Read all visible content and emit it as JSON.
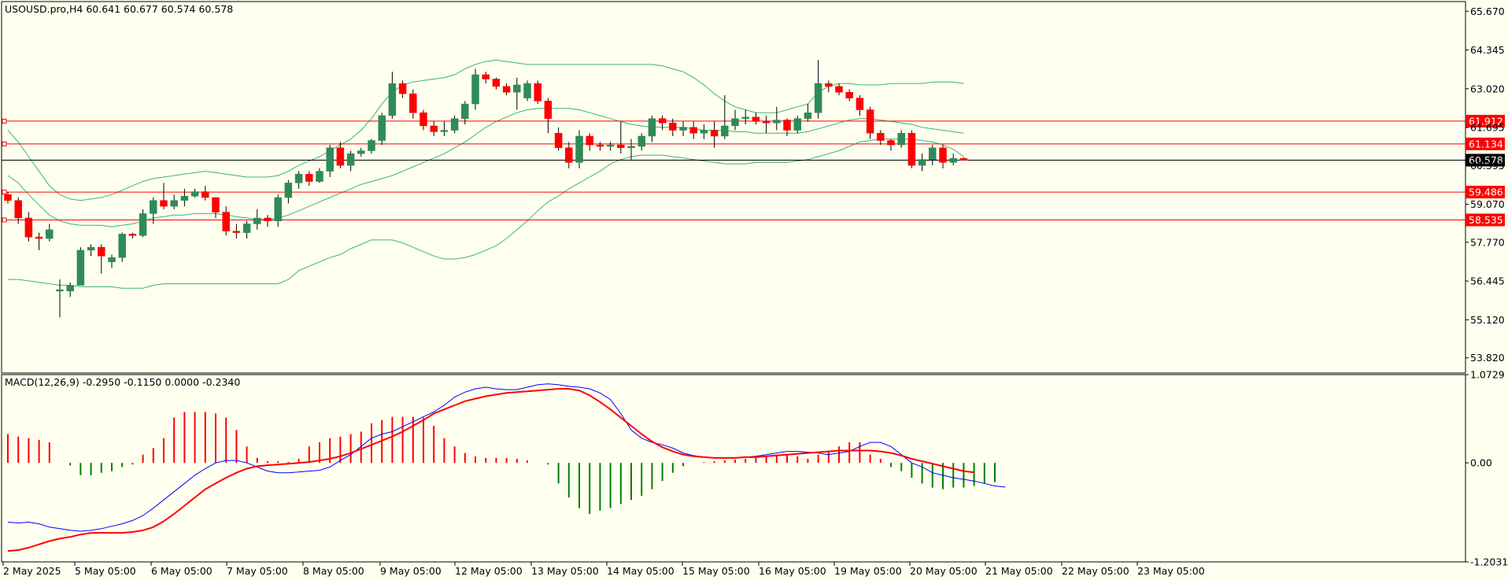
{
  "header": {
    "title": "USOUSD.pro,H4  60.641 60.677 60.574 60.578",
    "macd_title": "MACD(12,26,9) -0.2950 -0.1150 0.0000 -0.2340"
  },
  "colors": {
    "background": "#fffff0",
    "bull": "#2e8b57",
    "bear": "#ff0000",
    "bands": "#3cb371",
    "hline": "#ff0000",
    "price_line": "#000000",
    "macd_line": "#0000ff",
    "signal_line": "#ff0000",
    "hist_pos": "#ff0000",
    "hist_neg": "#008000"
  },
  "chart_data": [
    {
      "type": "candlestick",
      "symbol": "USOUSD.pro",
      "timeframe": "H4",
      "ylim": [
        53.3,
        66.0
      ],
      "yticks": [
        "65.670",
        "64.345",
        "63.020",
        "61.695",
        "60.395",
        "59.070",
        "57.770",
        "56.445",
        "55.120",
        "53.820"
      ],
      "xticks": [
        "2 May 2025",
        "5 May 05:00",
        "6 May 05:00",
        "7 May 05:00",
        "8 May 05:00",
        "9 May 05:00",
        "12 May 05:00",
        "13 May 05:00",
        "14 May 05:00",
        "15 May 05:00",
        "16 May 05:00",
        "19 May 05:00",
        "20 May 05:00",
        "21 May 05:00",
        "22 May 05:00",
        "23 May 05:00"
      ],
      "horizontal_lines": [
        {
          "label": "61.912",
          "value": 61.912
        },
        {
          "label": "61.134",
          "value": 61.134
        },
        {
          "label": "59.486",
          "value": 59.486
        },
        {
          "label": "58.535",
          "value": 58.535
        }
      ],
      "current_price": {
        "label": "60.578",
        "value": 60.578
      },
      "candles": [
        [
          59.4,
          59.2,
          59.5,
          59.1
        ],
        [
          59.2,
          58.6,
          59.3,
          58.4
        ],
        [
          58.6,
          57.95,
          58.8,
          57.8
        ],
        [
          57.95,
          57.9,
          58.1,
          57.5
        ],
        [
          57.9,
          58.2,
          58.4,
          57.8
        ],
        [
          56.1,
          56.15,
          56.5,
          55.2
        ],
        [
          56.1,
          56.3,
          56.4,
          55.9
        ],
        [
          56.3,
          57.5,
          57.6,
          56.3
        ],
        [
          57.5,
          57.6,
          57.7,
          57.3
        ],
        [
          57.6,
          57.3,
          57.7,
          56.7
        ],
        [
          57.1,
          57.25,
          57.35,
          56.9
        ],
        [
          57.25,
          58.05,
          58.1,
          57.1
        ],
        [
          58.05,
          58.0,
          58.1,
          57.9
        ],
        [
          58.0,
          58.75,
          58.9,
          57.95
        ],
        [
          58.75,
          59.2,
          59.3,
          58.4
        ],
        [
          59.2,
          59.0,
          59.8,
          58.9
        ],
        [
          59.0,
          59.2,
          59.4,
          58.9
        ],
        [
          59.2,
          59.35,
          59.6,
          59.0
        ],
        [
          59.35,
          59.5,
          59.6,
          59.3
        ],
        [
          59.5,
          59.3,
          59.7,
          59.2
        ],
        [
          59.3,
          58.8,
          59.3,
          58.6
        ],
        [
          58.8,
          58.15,
          59.0,
          58.0
        ],
        [
          58.15,
          58.1,
          58.4,
          57.9
        ],
        [
          58.1,
          58.4,
          58.5,
          57.9
        ],
        [
          58.4,
          58.6,
          58.9,
          58.2
        ],
        [
          58.6,
          58.5,
          58.7,
          58.3
        ],
        [
          58.5,
          59.3,
          59.4,
          58.3
        ],
        [
          59.3,
          59.8,
          59.9,
          59.1
        ],
        [
          59.8,
          60.1,
          60.2,
          59.6
        ],
        [
          60.1,
          59.85,
          60.2,
          59.7
        ],
        [
          59.85,
          60.2,
          60.3,
          59.8
        ],
        [
          60.2,
          61.0,
          61.1,
          60.0
        ],
        [
          61.0,
          60.4,
          61.2,
          60.3
        ],
        [
          60.4,
          60.8,
          60.9,
          60.2
        ],
        [
          60.8,
          60.9,
          61.0,
          60.7
        ],
        [
          60.9,
          61.25,
          61.3,
          60.8
        ],
        [
          61.25,
          62.1,
          62.2,
          61.1
        ],
        [
          62.1,
          63.2,
          63.6,
          62.0
        ],
        [
          63.2,
          62.85,
          63.3,
          62.7
        ],
        [
          62.85,
          62.2,
          63.0,
          62.0
        ],
        [
          62.2,
          61.75,
          62.3,
          61.6
        ],
        [
          61.75,
          61.55,
          61.9,
          61.4
        ],
        [
          61.55,
          61.6,
          61.9,
          61.4
        ],
        [
          61.6,
          62.0,
          62.1,
          61.5
        ],
        [
          62.0,
          62.5,
          62.6,
          61.8
        ],
        [
          62.5,
          63.5,
          63.7,
          62.3
        ],
        [
          63.5,
          63.35,
          63.6,
          63.2
        ],
        [
          63.35,
          63.1,
          63.4,
          63.0
        ],
        [
          63.1,
          62.9,
          63.2,
          62.8
        ],
        [
          62.9,
          63.15,
          63.4,
          62.3
        ],
        [
          62.7,
          63.2,
          63.3,
          62.6
        ],
        [
          63.2,
          62.6,
          63.3,
          62.5
        ],
        [
          62.6,
          62.0,
          62.7,
          61.5
        ],
        [
          61.5,
          61.0,
          61.7,
          60.9
        ],
        [
          61.0,
          60.5,
          61.2,
          60.3
        ],
        [
          60.5,
          61.4,
          61.6,
          60.3
        ],
        [
          61.4,
          61.1,
          61.5,
          60.9
        ],
        [
          61.1,
          61.05,
          61.2,
          60.9
        ],
        [
          61.05,
          61.1,
          61.2,
          60.9
        ],
        [
          61.1,
          61.0,
          61.9,
          60.8
        ],
        [
          61.0,
          61.05,
          61.3,
          60.6
        ],
        [
          61.05,
          61.4,
          61.5,
          60.9
        ],
        [
          61.4,
          62.0,
          62.1,
          61.2
        ],
        [
          62.0,
          61.85,
          62.1,
          61.6
        ],
        [
          61.85,
          61.6,
          62.0,
          61.4
        ],
        [
          61.6,
          61.7,
          61.9,
          61.4
        ],
        [
          61.7,
          61.5,
          61.9,
          61.3
        ],
        [
          61.5,
          61.6,
          61.8,
          61.3
        ],
        [
          61.6,
          61.4,
          61.9,
          61.0
        ],
        [
          61.4,
          61.75,
          62.8,
          61.3
        ],
        [
          61.75,
          62.0,
          62.3,
          61.6
        ],
        [
          62.0,
          62.05,
          62.3,
          61.8
        ],
        [
          62.05,
          61.9,
          62.2,
          61.8
        ],
        [
          61.9,
          61.85,
          62.1,
          61.5
        ],
        [
          61.85,
          61.95,
          62.4,
          61.6
        ],
        [
          61.95,
          61.6,
          62.0,
          61.4
        ],
        [
          61.6,
          62.0,
          62.1,
          61.5
        ],
        [
          62.0,
          62.2,
          62.5,
          61.9
        ],
        [
          62.2,
          63.2,
          64.0,
          62.0
        ],
        [
          63.2,
          63.1,
          63.3,
          62.9
        ],
        [
          63.1,
          62.9,
          63.2,
          62.8
        ],
        [
          62.9,
          62.7,
          63.0,
          62.6
        ],
        [
          62.7,
          62.3,
          62.8,
          62.1
        ],
        [
          62.3,
          61.5,
          62.4,
          61.3
        ],
        [
          61.5,
          61.25,
          61.6,
          61.1
        ],
        [
          61.25,
          61.1,
          61.3,
          60.9
        ],
        [
          61.1,
          61.5,
          61.6,
          61.0
        ],
        [
          61.5,
          60.4,
          61.6,
          60.3
        ],
        [
          60.4,
          60.6,
          60.8,
          60.2
        ],
        [
          60.6,
          61.0,
          61.1,
          60.4
        ],
        [
          61.0,
          60.5,
          61.1,
          60.3
        ],
        [
          60.5,
          60.641,
          60.8,
          60.4
        ],
        [
          60.641,
          60.578,
          60.677,
          60.574
        ]
      ],
      "bollinger": {
        "upper": [
          61.6,
          61.2,
          60.7,
          60.2,
          59.7,
          59.4,
          59.25,
          59.2,
          59.25,
          59.3,
          59.4,
          59.55,
          59.7,
          59.85,
          59.95,
          60.0,
          60.05,
          60.1,
          60.15,
          60.2,
          60.15,
          60.1,
          60.05,
          60.0,
          60.0,
          60.0,
          60.05,
          60.2,
          60.4,
          60.55,
          60.7,
          60.9,
          61.1,
          61.3,
          61.6,
          62.0,
          62.5,
          62.9,
          63.15,
          63.25,
          63.3,
          63.35,
          63.4,
          63.5,
          63.7,
          63.85,
          63.95,
          64.0,
          63.95,
          63.9,
          63.85,
          63.85,
          63.85,
          63.85,
          63.85,
          63.85,
          63.85,
          63.85,
          63.85,
          63.85,
          63.85,
          63.85,
          63.85,
          63.8,
          63.7,
          63.6,
          63.4,
          63.15,
          62.85,
          62.6,
          62.4,
          62.3,
          62.2,
          62.2,
          62.2,
          62.3,
          62.4,
          62.5,
          62.9,
          63.1,
          63.2,
          63.2,
          63.15,
          63.15,
          63.15,
          63.2,
          63.2,
          63.2,
          63.2,
          63.25,
          63.25,
          63.25,
          63.2
        ],
        "middle": [
          60.05,
          59.8,
          59.4,
          59.05,
          58.7,
          58.5,
          58.4,
          58.35,
          58.35,
          58.35,
          58.3,
          58.35,
          58.4,
          58.5,
          58.6,
          58.65,
          58.7,
          58.7,
          58.75,
          58.75,
          58.75,
          58.7,
          58.65,
          58.6,
          58.55,
          58.55,
          58.6,
          58.7,
          58.85,
          59.0,
          59.15,
          59.3,
          59.45,
          59.6,
          59.75,
          59.85,
          59.95,
          60.05,
          60.2,
          60.35,
          60.5,
          60.65,
          60.8,
          61.0,
          61.2,
          61.45,
          61.7,
          61.9,
          62.05,
          62.2,
          62.3,
          62.35,
          62.35,
          62.35,
          62.35,
          62.3,
          62.2,
          62.1,
          62.0,
          61.9,
          61.8,
          61.75,
          61.7,
          61.7,
          61.7,
          61.7,
          61.65,
          61.6,
          61.6,
          61.6,
          61.55,
          61.55,
          61.5,
          61.5,
          61.5,
          61.5,
          61.5,
          61.55,
          61.65,
          61.75,
          61.85,
          61.95,
          62.0,
          62.0,
          61.95,
          61.9,
          61.85,
          61.8,
          61.7,
          61.65,
          61.6,
          61.55,
          61.5
        ],
        "lower": [
          56.5,
          56.5,
          56.45,
          56.4,
          56.35,
          56.3,
          56.3,
          56.25,
          56.25,
          56.25,
          56.25,
          56.2,
          56.2,
          56.2,
          56.3,
          56.35,
          56.35,
          56.35,
          56.35,
          56.35,
          56.35,
          56.35,
          56.35,
          56.35,
          56.35,
          56.35,
          56.35,
          56.5,
          56.8,
          56.95,
          57.1,
          57.25,
          57.35,
          57.55,
          57.7,
          57.85,
          57.85,
          57.85,
          57.75,
          57.6,
          57.45,
          57.3,
          57.2,
          57.2,
          57.25,
          57.35,
          57.5,
          57.65,
          57.9,
          58.2,
          58.5,
          58.85,
          59.15,
          59.35,
          59.6,
          59.8,
          60.0,
          60.2,
          60.45,
          60.6,
          60.7,
          60.75,
          60.75,
          60.75,
          60.7,
          60.65,
          60.6,
          60.55,
          60.5,
          60.45,
          60.45,
          60.45,
          60.5,
          60.5,
          60.5,
          60.5,
          60.55,
          60.6,
          60.7,
          60.8,
          60.9,
          61.05,
          61.2,
          61.25,
          61.3,
          61.3,
          61.3,
          61.3,
          61.25,
          61.2,
          61.1,
          60.95,
          60.7
        ]
      }
    },
    {
      "type": "macd",
      "ylim": [
        -1.2031,
        1.0729
      ],
      "yticks": [
        "1.0729",
        "0.00",
        "-1.2031"
      ],
      "histogram": [
        0.35,
        0.32,
        0.3,
        0.28,
        0.25,
        0.0,
        -0.03,
        -0.15,
        -0.15,
        -0.12,
        -0.1,
        -0.05,
        -0.02,
        0.1,
        0.18,
        0.3,
        0.55,
        0.62,
        0.62,
        0.62,
        0.6,
        0.55,
        0.4,
        0.2,
        0.06,
        0.02,
        0.02,
        0.01,
        0.05,
        0.2,
        0.25,
        0.3,
        0.32,
        0.35,
        0.38,
        0.48,
        0.52,
        0.56,
        0.56,
        0.56,
        0.55,
        0.45,
        0.3,
        0.2,
        0.12,
        0.08,
        0.06,
        0.06,
        0.06,
        0.05,
        0.03,
        0.0,
        -0.02,
        -0.25,
        -0.42,
        -0.55,
        -0.62,
        -0.58,
        -0.55,
        -0.5,
        -0.45,
        -0.4,
        -0.32,
        -0.22,
        -0.12,
        -0.04,
        0.0,
        0.01,
        0.02,
        0.03,
        0.04,
        0.05,
        0.06,
        0.08,
        0.1,
        0.1,
        0.08,
        0.05,
        0.1,
        0.14,
        0.2,
        0.25,
        0.25,
        0.1,
        0.05,
        -0.05,
        -0.1,
        -0.18,
        -0.25,
        -0.3,
        -0.32,
        -0.3,
        -0.3,
        -0.28,
        -0.25,
        -0.234
      ],
      "macd": [
        -0.72,
        -0.73,
        -0.72,
        -0.74,
        -0.78,
        -0.8,
        -0.82,
        -0.83,
        -0.82,
        -0.8,
        -0.77,
        -0.74,
        -0.7,
        -0.64,
        -0.55,
        -0.45,
        -0.35,
        -0.25,
        -0.15,
        -0.07,
        0.0,
        0.03,
        0.03,
        0.0,
        -0.05,
        -0.1,
        -0.12,
        -0.12,
        -0.11,
        -0.1,
        -0.09,
        -0.05,
        0.03,
        0.1,
        0.2,
        0.3,
        0.35,
        0.38,
        0.44,
        0.5,
        0.56,
        0.62,
        0.7,
        0.8,
        0.86,
        0.9,
        0.92,
        0.9,
        0.89,
        0.89,
        0.92,
        0.95,
        0.96,
        0.95,
        0.93,
        0.92,
        0.9,
        0.85,
        0.77,
        0.6,
        0.4,
        0.3,
        0.25,
        0.22,
        0.18,
        0.12,
        0.09,
        0.07,
        0.06,
        0.06,
        0.06,
        0.07,
        0.08,
        0.1,
        0.12,
        0.14,
        0.14,
        0.13,
        0.12,
        0.1,
        0.12,
        0.14,
        0.2,
        0.25,
        0.25,
        0.2,
        0.1,
        0.0,
        -0.05,
        -0.12,
        -0.15,
        -0.18,
        -0.2,
        -0.22,
        -0.25,
        -0.28,
        -0.295
      ],
      "signal": [
        -1.07,
        -1.06,
        -1.03,
        -0.99,
        -0.95,
        -0.92,
        -0.9,
        -0.87,
        -0.85,
        -0.85,
        -0.85,
        -0.85,
        -0.84,
        -0.82,
        -0.78,
        -0.71,
        -0.62,
        -0.52,
        -0.42,
        -0.32,
        -0.25,
        -0.18,
        -0.12,
        -0.07,
        -0.04,
        -0.03,
        -0.02,
        -0.01,
        0.0,
        0.01,
        0.03,
        0.05,
        0.08,
        0.12,
        0.17,
        0.22,
        0.27,
        0.32,
        0.38,
        0.45,
        0.52,
        0.6,
        0.65,
        0.7,
        0.75,
        0.78,
        0.81,
        0.83,
        0.85,
        0.86,
        0.87,
        0.88,
        0.89,
        0.9,
        0.9,
        0.88,
        0.82,
        0.74,
        0.65,
        0.55,
        0.45,
        0.35,
        0.26,
        0.19,
        0.14,
        0.1,
        0.08,
        0.07,
        0.06,
        0.06,
        0.06,
        0.07,
        0.07,
        0.08,
        0.09,
        0.1,
        0.11,
        0.12,
        0.13,
        0.14,
        0.15,
        0.15,
        0.15,
        0.15,
        0.14,
        0.12,
        0.09,
        0.05,
        0.02,
        -0.01,
        -0.04,
        -0.07,
        -0.1,
        -0.115
      ]
    }
  ]
}
